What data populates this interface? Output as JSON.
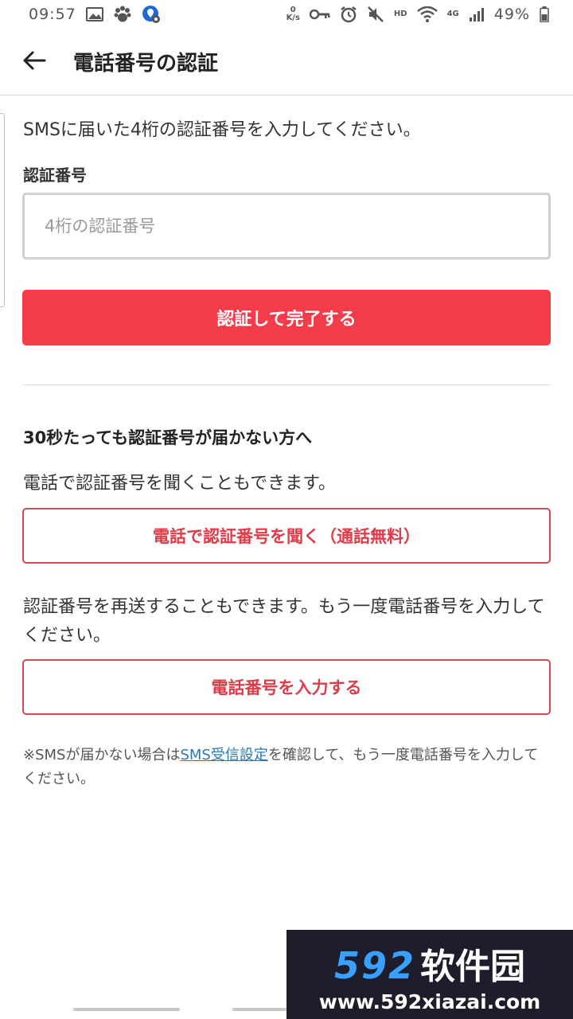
{
  "status_bar": {
    "time": "09:57",
    "net_speed_value": "0",
    "net_speed_unit": "K/s",
    "hd_label": "HD",
    "network_label": "4G",
    "battery_percent": "49%"
  },
  "header": {
    "title": "電話番号の認証"
  },
  "verify": {
    "instruction": "SMSに届いた4桁の認証番号を入力してください。",
    "field_label": "認証番号",
    "input_value": "",
    "input_placeholder": "4桁の認証番号",
    "submit_label": "認証して完了する"
  },
  "not_received": {
    "heading": "30秒たっても認証番号が届かない方へ",
    "phone_text": "電話で認証番号を聞くこともできます。",
    "phone_button_label": "電話で認証番号を聞く（通話無料）",
    "resend_text": "認証番号を再送することもできます。もう一度電話番号を入力してください。",
    "reenter_button_label": "電話番号を入力する"
  },
  "footnote": {
    "prefix": "※SMSが届かない場合は",
    "link_text": "SMS受信設定",
    "suffix": "を確認して、もう一度電話番号を入力してください。"
  },
  "watermark": {
    "digits": "592",
    "name": "软件园",
    "url": "www.592xiazai.com"
  },
  "colors": {
    "primary": "#f53c4a",
    "outline_text": "#e03a47",
    "link": "#2a78b8"
  },
  "icons": {
    "back": "arrow-left-icon",
    "status": [
      "image-icon",
      "baidu-paw-icon",
      "location-settings-icon",
      "key-icon",
      "alarm-icon",
      "mute-icon",
      "wifi-icon",
      "signal-icon",
      "battery-icon"
    ]
  }
}
